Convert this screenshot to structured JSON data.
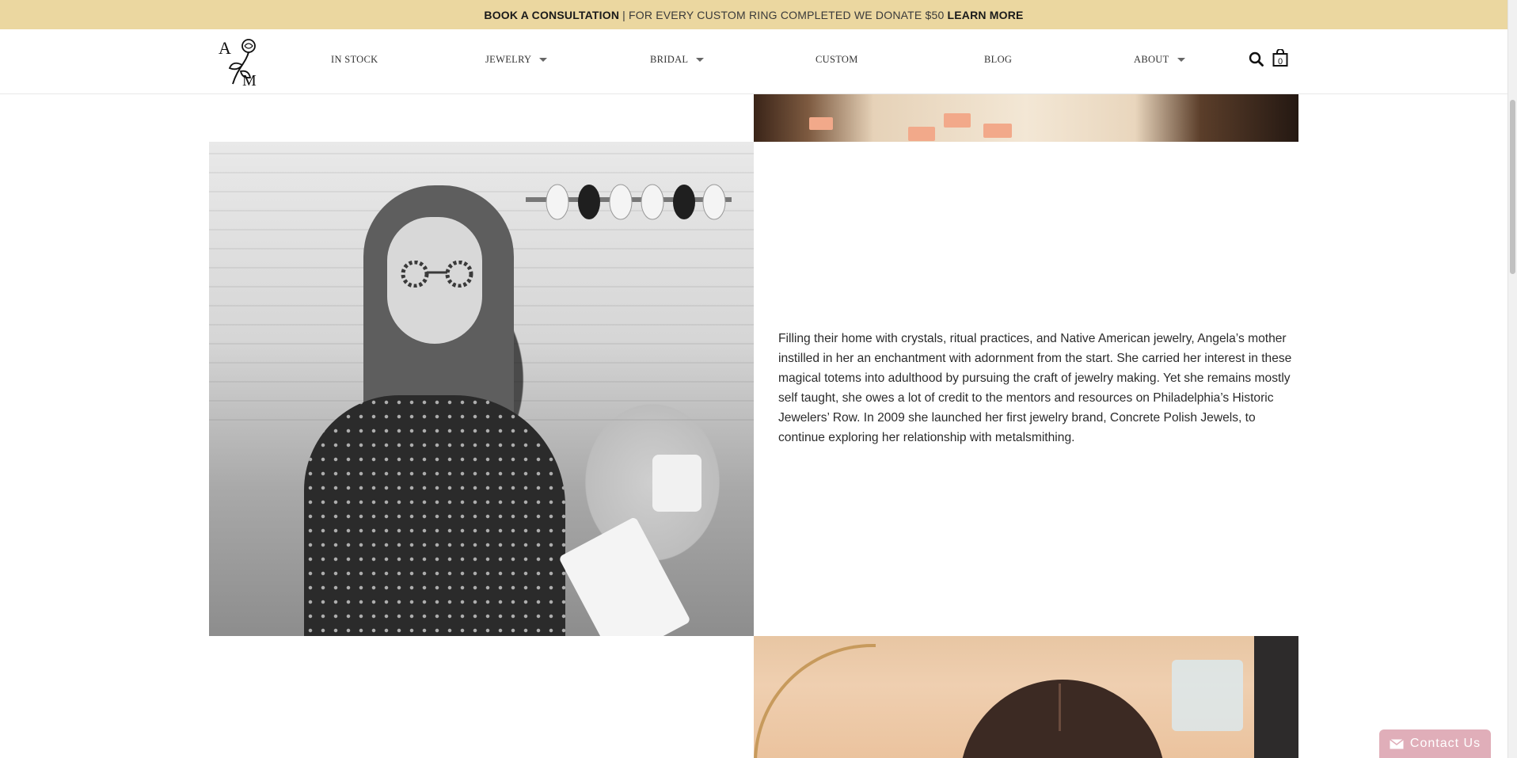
{
  "announcement": {
    "cta_left": "BOOK A CONSULTATION",
    "separator": "|",
    "message": "FOR EVERY CUSTOM RING COMPLETED WE DONATE $50",
    "cta_right": "LEARN MORE"
  },
  "header": {
    "logo_alt": "A M",
    "nav": [
      {
        "label": "IN STOCK",
        "dropdown": false
      },
      {
        "label": "JEWELRY",
        "dropdown": true
      },
      {
        "label": "BRIDAL",
        "dropdown": true
      },
      {
        "label": "CUSTOM",
        "dropdown": false
      },
      {
        "label": "BLOG",
        "dropdown": false
      },
      {
        "label": "ABOUT",
        "dropdown": true
      }
    ],
    "cart_count": "0"
  },
  "content": {
    "about_paragraph": "Filling their home with crystals, ritual practices, and Native American jewelry, Angela’s mother instilled in her an enchantment with adornment from the start. She carried her interest in these magical totems into adulthood by pursuing the craft of jewelry making. Yet she remains mostly self taught, she owes a lot of credit to the mentors and resources on Philadelphia’s Historic Jewelers’ Row. In 2009 she launched her first jewelry brand, Concrete Polish Jewels, to continue exploring her relationship with metalsmithing."
  },
  "contact_widget": {
    "label": "Contact Us"
  },
  "colors": {
    "announcement_bg": "#ebd7a0",
    "contact_bg": "#e0aeb9"
  }
}
